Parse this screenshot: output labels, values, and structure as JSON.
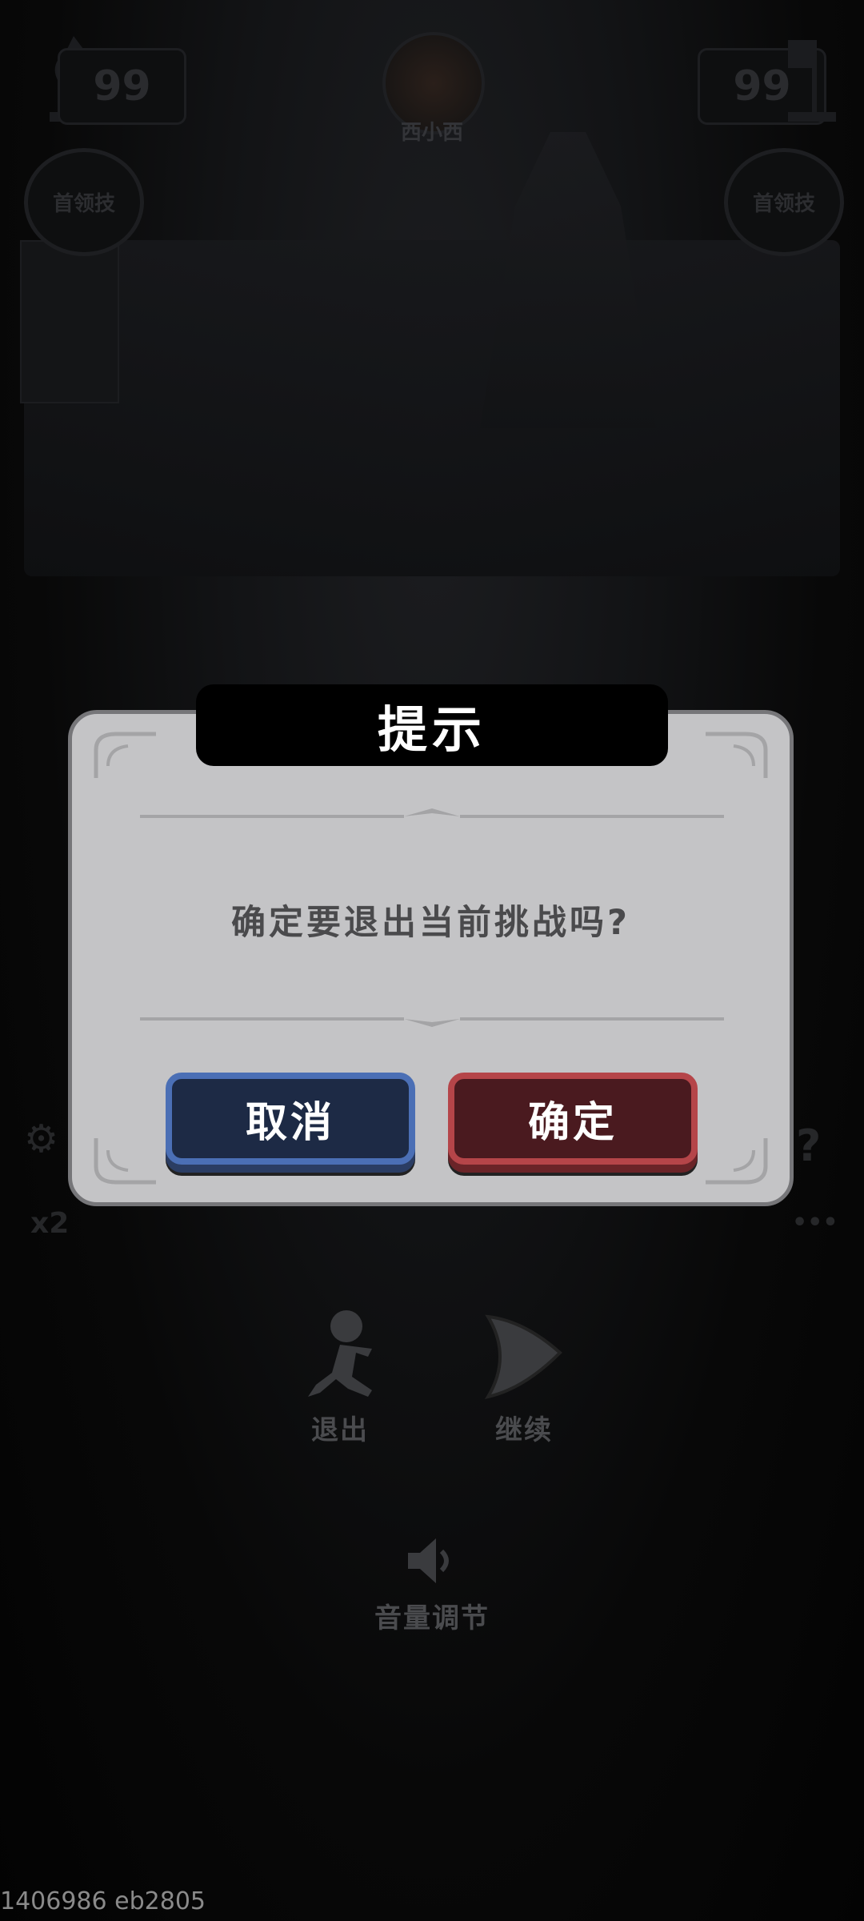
{
  "hud": {
    "left_count": "99",
    "right_count": "99",
    "left_skill": "首领技",
    "right_skill": "首领技",
    "player_name": "西小西",
    "speed_label": "x2",
    "help_icon_label": "?",
    "more_icon_label": "•••"
  },
  "dialog": {
    "title": "提示",
    "message": "确定要退出当前挑战吗?",
    "cancel_label": "取消",
    "confirm_label": "确定"
  },
  "menu": {
    "exit_label": "退出",
    "continue_label": "继续",
    "volume_label": "音量调节"
  },
  "footer": {
    "version": "1406986 eb2805"
  },
  "colors": {
    "cancel_button": "#4b6fb5",
    "confirm_button": "#b54549",
    "dialog_bg": "#c4c4c6"
  }
}
